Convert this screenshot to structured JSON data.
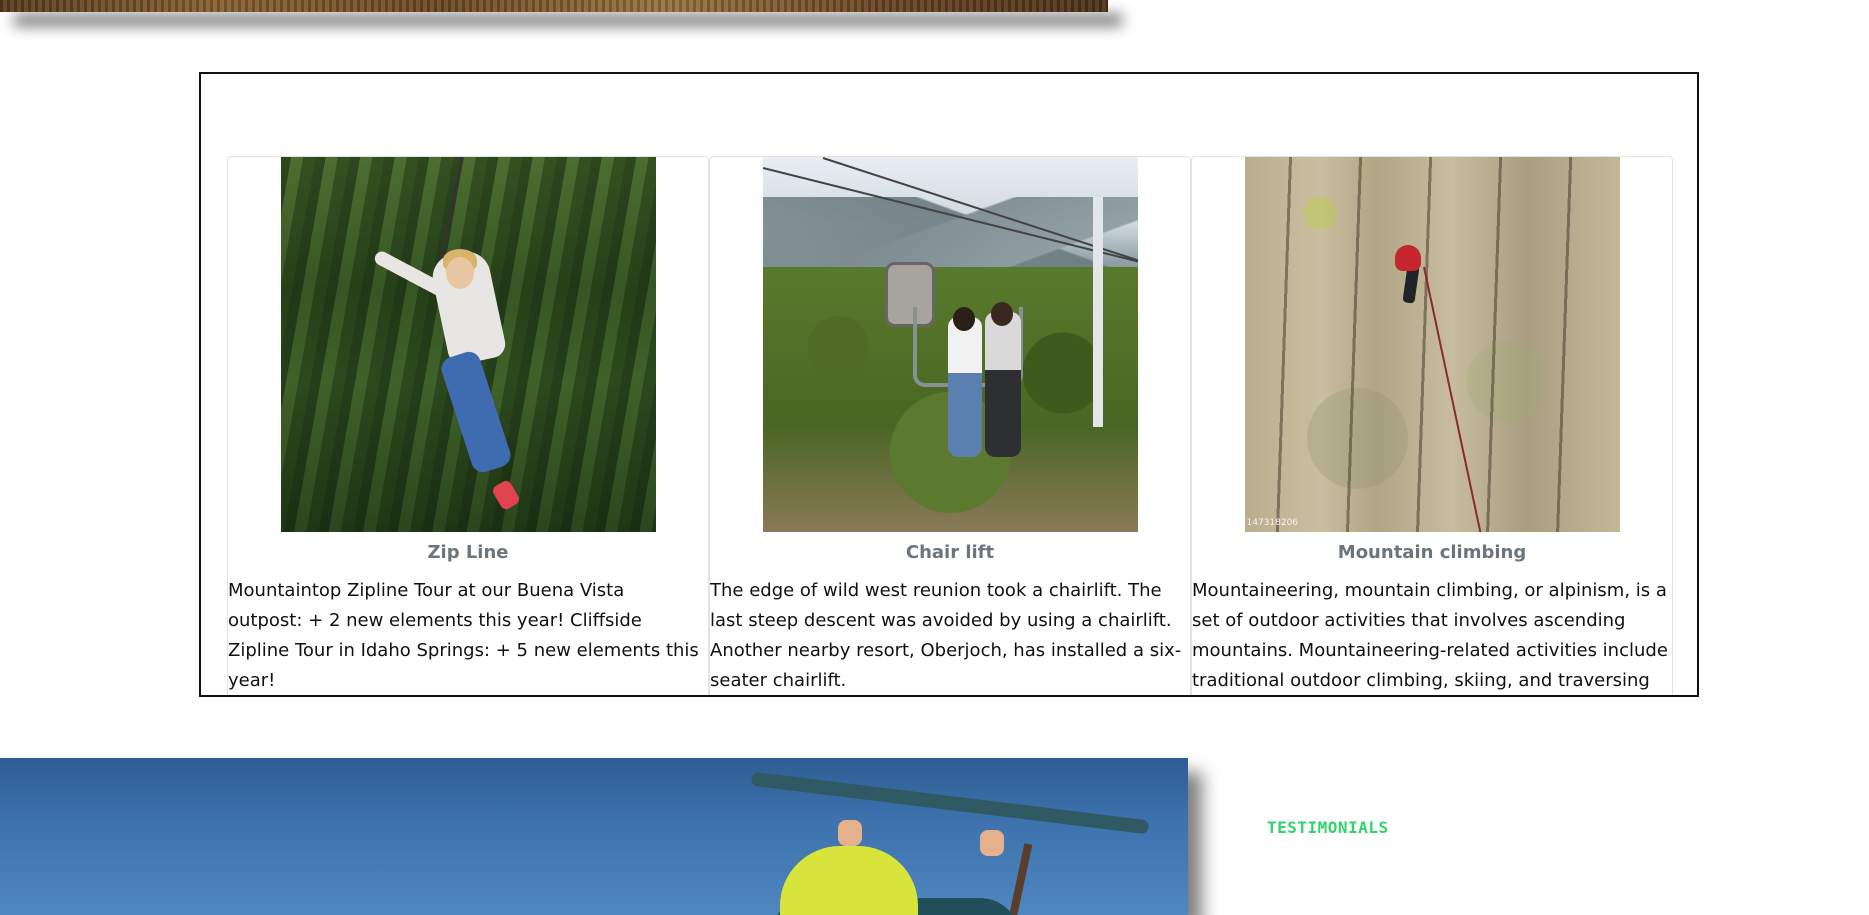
{
  "activities": {
    "cards": [
      {
        "title": "Zip Line",
        "text": "Mountaintop Zipline Tour at our Buena Vista outpost: + 2 new elements this year! Cliffside Zipline Tour in Idaho Springs: + 5 new elements this year!"
      },
      {
        "title": "Chair lift",
        "text": "The edge of wild west reunion took a chairlift. The last steep descent was avoided by using a chairlift. Another nearby resort, Oberjoch, has installed a six-seater chairlift."
      },
      {
        "title": "Mountain climbing",
        "text": "Mountaineering, mountain climbing, or alpinism, is a set of outdoor activities that involves ascending mountains. Mountaineering-related activities include traditional outdoor climbing, skiing, and traversing via",
        "image_caption": "147318206"
      }
    ]
  },
  "testimonials": {
    "label": "TESTIMONIALS"
  },
  "colors": {
    "accent_green": "#33d36b",
    "card_title": "#6c757d",
    "box_border": "#111111"
  }
}
